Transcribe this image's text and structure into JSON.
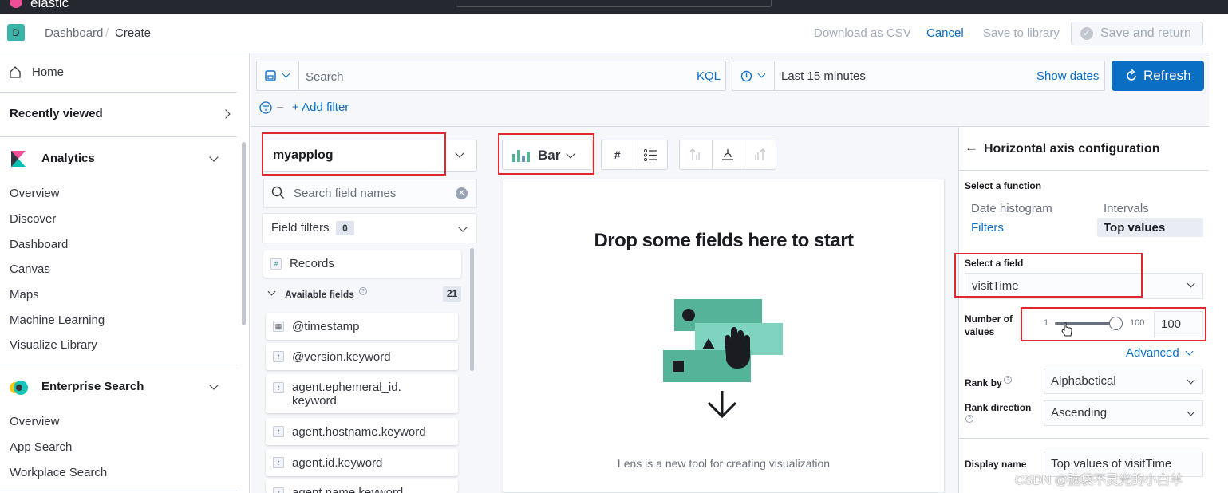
{
  "topbar": {
    "logo": "elastic"
  },
  "header": {
    "avatar": "D",
    "breadcrumb_1": "Dashboard",
    "breadcrumb_sep": "/",
    "breadcrumb_2": "Create",
    "download_csv": "Download as CSV",
    "cancel": "Cancel",
    "save_to_library": "Save to library",
    "save_and_return": "Save and return"
  },
  "sidebar": {
    "home": "Home",
    "recently_viewed": "Recently viewed",
    "analytics": {
      "title": "Analytics",
      "items": [
        "Overview",
        "Discover",
        "Dashboard",
        "Canvas",
        "Maps",
        "Machine Learning",
        "Visualize Library"
      ]
    },
    "enterprise": {
      "title": "Enterprise Search",
      "items": [
        "Overview",
        "App Search",
        "Workplace Search"
      ]
    }
  },
  "query": {
    "search_placeholder": "Search",
    "kql": "KQL",
    "time": "Last 15 minutes",
    "show_dates": "Show dates",
    "refresh": "Refresh",
    "add_filter": "+ Add filter"
  },
  "datasource": {
    "index": "myapplog",
    "search_placeholder": "Search field names",
    "field_filters": "Field filters",
    "filter_count": "0",
    "records": "Records",
    "available_fields": "Available fields",
    "available_count": "21",
    "fields": [
      {
        "type": "date",
        "name": "@timestamp"
      },
      {
        "type": "t",
        "name": "@version.keyword"
      },
      {
        "type": "t",
        "name": "agent.ephemeral_id.\nkeyword"
      },
      {
        "type": "t",
        "name": "agent.hostname.keyword"
      },
      {
        "type": "t",
        "name": "agent.id.keyword"
      },
      {
        "type": "t",
        "name": "agent.name.keyword"
      }
    ]
  },
  "workspace": {
    "chart_type": "Bar",
    "drop_title": "Drop some fields here to start",
    "drop_desc": "Lens is a new tool for creating visualization"
  },
  "config": {
    "title": "Horizontal axis configuration",
    "select_function": "Select a function",
    "functions": [
      "Date histogram",
      "Intervals",
      "Filters",
      "Top values"
    ],
    "selected_function": "Top values",
    "select_field": "Select a field",
    "field_value": "visitTime",
    "number_of_values": "Number of values",
    "slider_min": "1",
    "slider_max": "100",
    "slider_value": "100",
    "advanced": "Advanced",
    "rank_by": "Rank by",
    "rank_by_value": "Alphabetical",
    "rank_direction": "Rank direction",
    "rank_direction_value": "Ascending",
    "display_name": "Display name",
    "display_name_value": "Top values of visitTime"
  },
  "watermark": "CSDN @脑袋不灵光的小白羊",
  "colors": {
    "accent": "#0b6ec5",
    "teal": "#3ab3a8",
    "highlight": "#e0282f"
  }
}
